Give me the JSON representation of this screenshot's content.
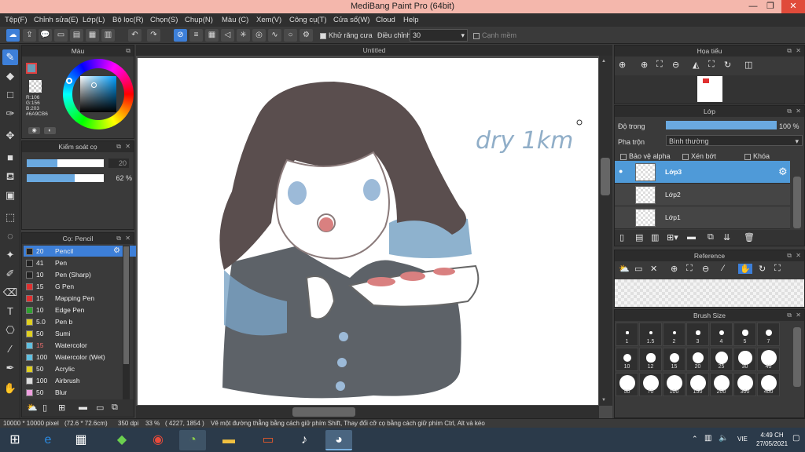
{
  "app": {
    "title": "MediBang Paint Pro (64bit)"
  },
  "window": {
    "minimize": "—",
    "restore": "❐",
    "close": "✕"
  },
  "menu": [
    "Tệp(F)",
    "Chỉnh sửa(E)",
    "Lớp(L)",
    "Bộ lọc(R)",
    "Chọn(S)",
    "Chụp(N)",
    "Màu (C)",
    "Xem(V)",
    "Công cụ(T)",
    "Cửa sổ(W)",
    "Cloud",
    "Help"
  ],
  "toolbar": {
    "antialias_label": "Khử răng cưa",
    "adjust_label": "Điều chỉnh",
    "adjust_value": "30",
    "smooth_label": "Cạnh mềm"
  },
  "color_panel": {
    "title": "Màu",
    "r": "R:106",
    "g": "G:156",
    "b": "B:203",
    "hex": "#6A9CB6",
    "main_color": "#6a9cb6"
  },
  "brush_control": {
    "title": "Kiểm soát cọ",
    "size_value": "20",
    "opacity_value": "62 %"
  },
  "brush_panel": {
    "title": "Cọ: Pencil",
    "items": [
      {
        "size": "20",
        "name": "Pencil",
        "color": "#222222"
      },
      {
        "size": "41",
        "name": "Pen",
        "color": "#222222"
      },
      {
        "size": "10",
        "name": "Pen (Sharp)",
        "color": "#222222"
      },
      {
        "size": "15",
        "name": "G Pen",
        "color": "#e03030"
      },
      {
        "size": "15",
        "name": "Mapping Pen",
        "color": "#e03030"
      },
      {
        "size": "10",
        "name": "Edge Pen",
        "color": "#30a030"
      },
      {
        "size": "5.0",
        "name": "Pen b",
        "color": "#e0d020"
      },
      {
        "size": "50",
        "name": "Sumi",
        "color": "#e0d020"
      },
      {
        "size": "15",
        "name": "Watercolor",
        "color": "#60c0e0"
      },
      {
        "size": "100",
        "name": "Watercolor (Wet)",
        "color": "#60c0e0"
      },
      {
        "size": "50",
        "name": "Acrylic",
        "color": "#e0d020"
      },
      {
        "size": "100",
        "name": "Airbrush",
        "color": "#dddddd"
      },
      {
        "size": "50",
        "name": "Blur",
        "color": "#f0a0e0"
      }
    ]
  },
  "document": {
    "tab": "Untitled",
    "signature": "dry 1km"
  },
  "navigator": {
    "title": "Họa tiểu"
  },
  "layer_panel": {
    "title": "Lớp",
    "opacity_label": "Độ trong",
    "opacity_value": "100 %",
    "opacity_fraction": 1.0,
    "blend_label": "Pha trộn",
    "blend_value": "Bình thường",
    "protect_alpha": "Bảo vệ alpha",
    "clipping": "Xén bớt",
    "lock": "Khóa",
    "layers": [
      {
        "name": "Lớp3"
      },
      {
        "name": "Lớp2"
      },
      {
        "name": "Lớp1"
      }
    ]
  },
  "reference_panel": {
    "title": "Reference"
  },
  "brush_size_panel": {
    "title": "Brush Size",
    "sizes": [
      "1",
      "1.5",
      "2",
      "3",
      "4",
      "5",
      "7",
      "10",
      "12",
      "15",
      "20",
      "25",
      "30",
      "40",
      "50",
      "70",
      "100",
      "150",
      "200",
      "300",
      "400"
    ]
  },
  "status": {
    "size": "10000 * 10000 pixel",
    "cm": "(72.6 * 72.6cm)",
    "dpi": "350 dpi",
    "zoom": "33 %",
    "coords": "( 4227, 1854 )",
    "hint": "Vẽ một đường thẳng bằng cách giữ phím Shift, Thay đổi cỡ cọ bằng cách giữ phím Ctrl, Alt và kéo"
  },
  "taskbar": {
    "time": "4:49 CH",
    "date": "27/05/2021",
    "lang": "VIE"
  }
}
